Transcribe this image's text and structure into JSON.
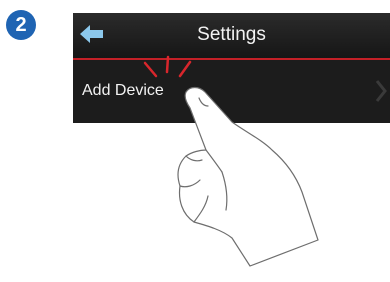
{
  "step": {
    "number": "2"
  },
  "title_bar": {
    "title": "Settings",
    "back_icon": "back-arrow-icon"
  },
  "menu": {
    "items": [
      {
        "label": "Add Device",
        "icon": "chevron-right-icon"
      }
    ]
  },
  "illustration": {
    "icon": "pointing-hand-icon",
    "tap_marks": "tap-indicator-icon"
  },
  "colors": {
    "accent": "#c42027",
    "badge": "#1f64b3",
    "back_arrow": "#8cc8ec",
    "screen": "#1b1b1b"
  }
}
